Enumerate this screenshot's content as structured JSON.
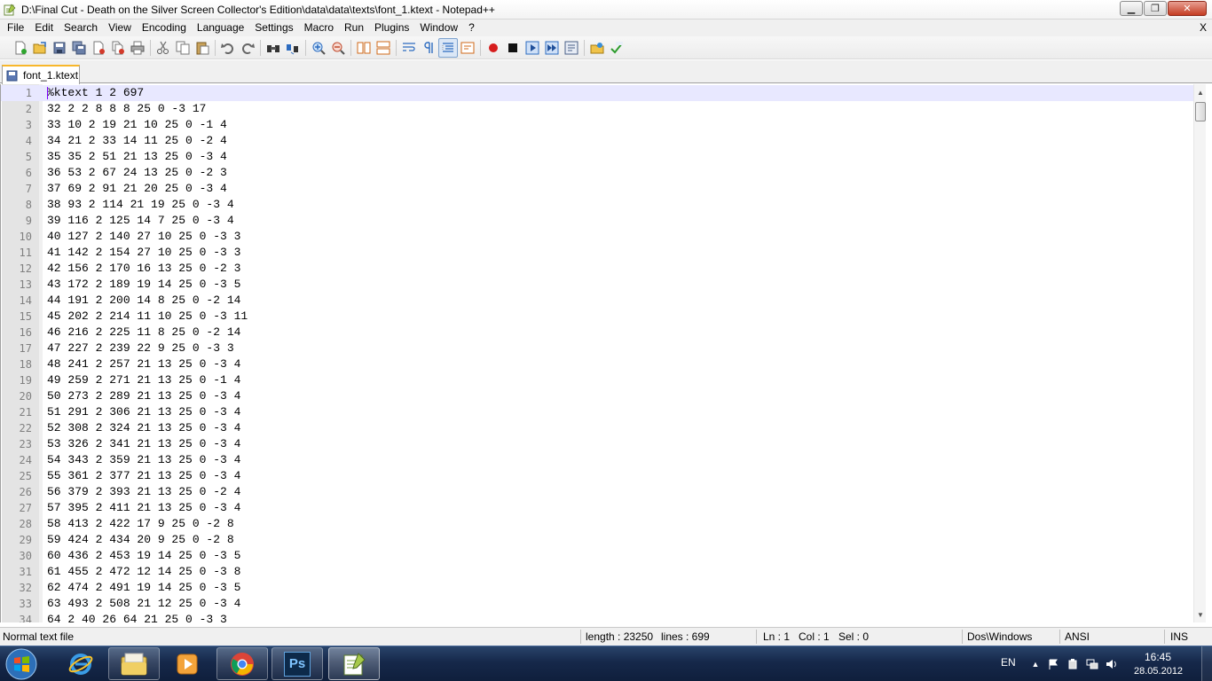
{
  "window": {
    "title": "D:\\Final Cut - Death on the Silver Screen Collector's Edition\\data\\data\\texts\\font_1.ktext - Notepad++",
    "minimize": "▁",
    "maximize": "❐",
    "close": "✕"
  },
  "menubar": {
    "items": [
      "File",
      "Edit",
      "Search",
      "View",
      "Encoding",
      "Language",
      "Settings",
      "Macro",
      "Run",
      "Plugins",
      "Window",
      "?"
    ],
    "close_label": "X"
  },
  "toolbar": {
    "icons": [
      "new-file-icon",
      "open-file-icon",
      "save-icon",
      "save-all-icon",
      "close-icon",
      "close-all-icon",
      "print-icon",
      "cut-icon",
      "copy-icon",
      "paste-icon",
      "undo-icon",
      "redo-icon",
      "find-icon",
      "replace-icon",
      "zoom-in-icon",
      "zoom-out-icon",
      "sync-vertical-icon",
      "sync-horizontal-icon",
      "word-wrap-icon",
      "show-all-chars-icon",
      "indent-guide-icon",
      "user-lang-icon",
      "record-macro-icon",
      "stop-record-icon",
      "play-macro-icon",
      "run-macro-multiple-icon",
      "save-macro-icon",
      "launch-browser-icon",
      "spell-check-icon"
    ]
  },
  "tabs": [
    {
      "label": "font_1.ktext",
      "active": true
    }
  ],
  "editor": {
    "current_line": 1,
    "lines": [
      "%ktext 1 2 697",
      "32 2 2 8 8 8 25 0 -3 17",
      "33 10 2 19 21 10 25 0 -1 4",
      "34 21 2 33 14 11 25 0 -2 4",
      "35 35 2 51 21 13 25 0 -3 4",
      "36 53 2 67 24 13 25 0 -2 3",
      "37 69 2 91 21 20 25 0 -3 4",
      "38 93 2 114 21 19 25 0 -3 4",
      "39 116 2 125 14 7 25 0 -3 4",
      "40 127 2 140 27 10 25 0 -3 3",
      "41 142 2 154 27 10 25 0 -3 3",
      "42 156 2 170 16 13 25 0 -2 3",
      "43 172 2 189 19 14 25 0 -3 5",
      "44 191 2 200 14 8 25 0 -2 14",
      "45 202 2 214 11 10 25 0 -3 11",
      "46 216 2 225 11 8 25 0 -2 14",
      "47 227 2 239 22 9 25 0 -3 3",
      "48 241 2 257 21 13 25 0 -3 4",
      "49 259 2 271 21 13 25 0 -1 4",
      "50 273 2 289 21 13 25 0 -3 4",
      "51 291 2 306 21 13 25 0 -3 4",
      "52 308 2 324 21 13 25 0 -3 4",
      "53 326 2 341 21 13 25 0 -3 4",
      "54 343 2 359 21 13 25 0 -3 4",
      "55 361 2 377 21 13 25 0 -3 4",
      "56 379 2 393 21 13 25 0 -2 4",
      "57 395 2 411 21 13 25 0 -3 4",
      "58 413 2 422 17 9 25 0 -2 8",
      "59 424 2 434 20 9 25 0 -2 8",
      "60 436 2 453 19 14 25 0 -3 5",
      "61 455 2 472 12 14 25 0 -3 8",
      "62 474 2 491 19 14 25 0 -3 5",
      "63 493 2 508 21 12 25 0 -3 4",
      "64 2 40 26 64 21 25 0 -3 3"
    ]
  },
  "statusbar": {
    "file_type": "Normal text file",
    "length": "length : 23250",
    "lines": "lines : 699",
    "ln": "Ln : 1",
    "col": "Col : 1",
    "sel": "Sel : 0",
    "eol": "Dos\\Windows",
    "encoding": "ANSI",
    "mode": "INS"
  },
  "taskbar": {
    "apps": [
      "windows-explorer-icon",
      "internet-explorer-icon",
      "file-explorer-icon",
      "media-player-icon",
      "chrome-icon",
      "photoshop-icon",
      "notepad-plus-plus-icon"
    ],
    "photoshop_label": "Ps",
    "language": "EN",
    "time": "16:45",
    "date": "28.05.2012"
  },
  "colors": {
    "current_line": "#e8e8ff",
    "tab_accent": "#f8b72b",
    "caret": "#8000ff",
    "gutter": "#e4e4e4",
    "taskbar": "#16284a"
  }
}
